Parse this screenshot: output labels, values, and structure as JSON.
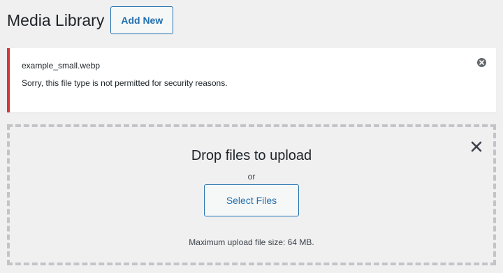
{
  "header": {
    "title": "Media Library",
    "add_new_label": "Add New"
  },
  "notice": {
    "filename": "example_small.webp",
    "message": "Sorry, this file type is not permitted for security reasons.",
    "dismiss_icon": "dismiss-icon",
    "accent_color": "#d63638"
  },
  "uploader": {
    "drop_title": "Drop files to upload",
    "or_text": "or",
    "select_files_label": "Select Files",
    "max_size_text": "Maximum upload file size: 64 MB.",
    "close_icon": "close-icon"
  },
  "colors": {
    "primary": "#2271b1",
    "background": "#f0f0f1",
    "dashed_border": "#c3c4c7"
  }
}
